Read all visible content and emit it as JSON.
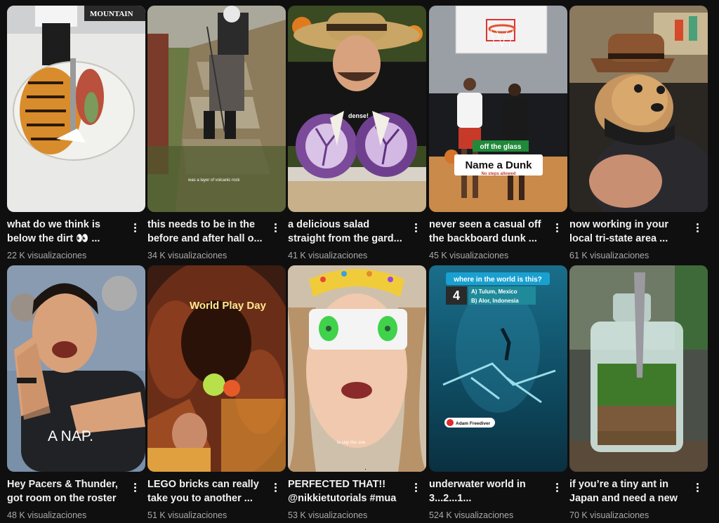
{
  "videos": [
    {
      "title": "what do we think is\nbelow the dirt 👀 ...",
      "views": "22 K visualizaciones",
      "overlay": "MOUNTAIN"
    },
    {
      "title": "this needs to be in the\nbefore and after hall o...",
      "views": "34 K visualizaciones",
      "overlay": "was a layer of volcanic rock"
    },
    {
      "title": "a delicious salad\nstraight from the gard...",
      "views": "41 K visualizaciones",
      "overlay": "dense!"
    },
    {
      "title": "never seen a casual off\nthe backboard dunk ...",
      "views": "45 K visualizaciones",
      "overlay_top": "off the glass",
      "overlay_main": "Name a Dunk",
      "overlay_sub": "No steps allowed"
    },
    {
      "title": "now working in your\nlocal tri-state area ...",
      "views": "61 K visualizaciones"
    },
    {
      "title": "Hey Pacers & Thunder,\ngot room on the roster ...",
      "views": "48 K visualizaciones",
      "overlay": "A NAP."
    },
    {
      "title": "LEGO bricks can really\ntake you to another ...",
      "views": "51 K visualizaciones",
      "overlay": "World Play Day"
    },
    {
      "title": "PERFECTED THAT!!\n@nikkietutorials #mua ...",
      "views": "53 K visualizaciones",
      "overlay": "to skip this one."
    },
    {
      "title": "underwater world in\n3...2...1...",
      "views": "524 K visualizaciones",
      "overlay_q": "where in the world is this?",
      "overlay_num": "4",
      "overlay_a": "A) Tulum, Mexico",
      "overlay_b": "B) Alor, Indonesia",
      "overlay_tag": "Adam Freediver"
    },
    {
      "title": "if you’re a tiny ant in\nJapan and need a new ...",
      "views": "70 K visualizaciones"
    }
  ]
}
